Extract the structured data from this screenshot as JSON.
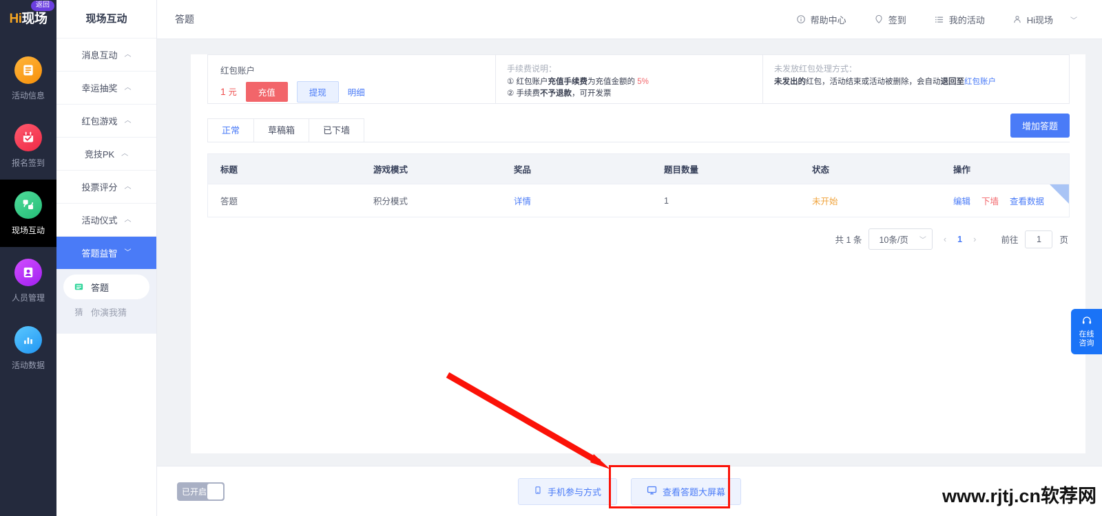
{
  "brand": {
    "logo_h": "Hi",
    "logo_cn": "现场",
    "back_label": "返回"
  },
  "rail": {
    "items": [
      {
        "label": "活动信息",
        "icon": "document-icon",
        "active": false
      },
      {
        "label": "报名签到",
        "icon": "calendar-check-icon",
        "active": false
      },
      {
        "label": "现场互动",
        "icon": "interaction-icon",
        "active": true
      },
      {
        "label": "人员管理",
        "icon": "user-card-icon",
        "active": false
      },
      {
        "label": "活动数据",
        "icon": "bar-chart-icon",
        "active": false
      }
    ]
  },
  "nav2": {
    "title": "现场互动",
    "items": [
      {
        "label": "消息互动",
        "caret": "︿",
        "active": false
      },
      {
        "label": "幸运抽奖",
        "caret": "︿",
        "active": false
      },
      {
        "label": "红包游戏",
        "caret": "︿",
        "active": false
      },
      {
        "label": "竞技PK",
        "caret": "︿",
        "active": false
      },
      {
        "label": "投票评分",
        "caret": "︿",
        "active": false
      },
      {
        "label": "活动仪式",
        "caret": "︿",
        "active": false
      },
      {
        "label": "答题益智",
        "caret": "﹀",
        "active": true
      }
    ],
    "sub_items": [
      {
        "label": "答题",
        "icon": "quiz-icon",
        "glyph": "▤",
        "active": true
      },
      {
        "label": "你演我猜",
        "icon": "guess-icon",
        "glyph": "猜",
        "active": false
      }
    ]
  },
  "header": {
    "page_title": "答题",
    "menu": [
      {
        "label": "帮助中心",
        "icon": "info-circle-icon"
      },
      {
        "label": "签到",
        "icon": "location-pin-icon"
      },
      {
        "label": "我的活动",
        "icon": "list-icon"
      }
    ],
    "user": {
      "name": "Hi现场",
      "icon": "user-icon",
      "caret": "﹀"
    }
  },
  "red_packet": {
    "account_title": "红包账户",
    "amount": "1",
    "unit": "元",
    "recharge_label": "充值",
    "withdraw_label": "提现",
    "detail_label": "明细",
    "fee_heading": "手续费说明：",
    "fee_line1_pre": "① 红包账户",
    "fee_line1_bold": "充值手续费",
    "fee_line1_mid": "为充值金额的 ",
    "fee_line1_rate": "5%",
    "fee_line2_pre": "② 手续费",
    "fee_line2_bold": "不予退款",
    "fee_line2_post": "，可开发票",
    "unsent_heading": "未发放红包处理方式：",
    "unsent_bold1": "未发出的",
    "unsent_text1": "红包，活动结束或活动被删除，会自动",
    "unsent_bold2": "退回至",
    "unsent_link": "红包账户"
  },
  "tabs": [
    {
      "label": "正常",
      "active": true
    },
    {
      "label": "草稿箱",
      "active": false
    },
    {
      "label": "已下墙",
      "active": false
    }
  ],
  "add_button_label": "增加答题",
  "table": {
    "columns": [
      "标题",
      "游戏模式",
      "奖品",
      "题目数量",
      "状态",
      "操作"
    ],
    "rows": [
      {
        "title": "答题",
        "mode": "积分模式",
        "prize_link": "详情",
        "count": "1",
        "status": "未开始",
        "ops": [
          {
            "label": "编辑",
            "style": "blue"
          },
          {
            "label": "下墙",
            "style": "red"
          },
          {
            "label": "查看数据",
            "style": "blue"
          }
        ]
      }
    ]
  },
  "pagination": {
    "total_text": "共 1 条",
    "page_size": "10条/页",
    "prev": "‹",
    "current_page": "1",
    "next": "›",
    "goto_label": "前往",
    "goto_value": "1",
    "page_unit": "页"
  },
  "footer": {
    "toggle_label": "已开启",
    "buttons": [
      {
        "label": "手机参与方式",
        "icon": "mobile-icon",
        "glyph": "▯"
      },
      {
        "label": "查看答题大屏幕",
        "icon": "monitor-icon",
        "glyph": "🖵"
      }
    ]
  },
  "chat_widget": {
    "line1": "在线",
    "line2": "咨询",
    "icon": "headset-icon"
  },
  "watermark": "www.rjtj.cn软荐网",
  "colors": {
    "accent_blue": "#4a7bf7",
    "rail_bg": "#242a3d",
    "danger_red": "#f2656a",
    "status_orange": "#f0a33c",
    "annotation_red": "#fb1208"
  }
}
